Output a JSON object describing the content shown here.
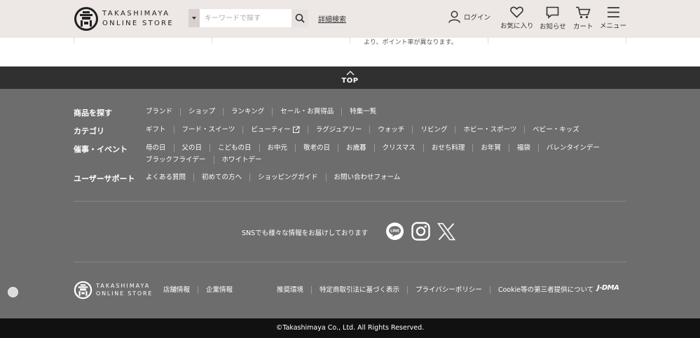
{
  "header": {
    "logo_line1": "TAKASHIMAYA",
    "logo_line2": "ONLINE STORE",
    "search_placeholder": "キーワードで探す",
    "detail_search": "詳細検索",
    "login": "ログイン",
    "favorites": "お気に入り",
    "notifications": "お知らせ",
    "cart": "カート",
    "menu": "メニュー"
  },
  "content_snippet": "より、ポイント率が異なります。",
  "top_button": "TOP",
  "footer": {
    "sections": [
      {
        "title": "商品を探す",
        "links": [
          "ブランド",
          "ショップ",
          "ランキング",
          "セール・お買得品",
          "特集一覧"
        ]
      },
      {
        "title": "カテゴリ",
        "links": [
          "ギフト",
          "フード・スイーツ",
          "ビューティー",
          "ラグジュアリー",
          "ウォッチ",
          "リビング",
          "ホビー・スポーツ",
          "ベビー・キッズ"
        ]
      },
      {
        "title": "催事・イベント",
        "links": [
          "母の日",
          "父の日",
          "こどもの日",
          "お中元",
          "敬老の日",
          "お歳暮",
          "クリスマス",
          "おせち料理",
          "お年賀",
          "福袋",
          "バレンタインデー",
          "ブラックフライデー",
          "ホワイトデー"
        ]
      },
      {
        "title": "ユーザーサポート",
        "links": [
          "よくある質問",
          "初めての方へ",
          "ショッピングガイド",
          "お問い合わせフォーム"
        ]
      }
    ],
    "sns_text": "SNSでも様々な情報をお届けしております",
    "line_icon_text": "LINE",
    "logo_line1": "TAKASHIMAYA",
    "logo_line2": "ONLINE STORE",
    "company_links": [
      "店舗情報",
      "企業情報"
    ],
    "policy_links": [
      "推奨環境",
      "特定商取引法に基づく表示",
      "プライバシーポリシー",
      "Cookie等の第三者提供について"
    ],
    "jdma": "J-DMA",
    "copyright": "©Takashimaya Co., Ltd. All Rights Reserved."
  }
}
